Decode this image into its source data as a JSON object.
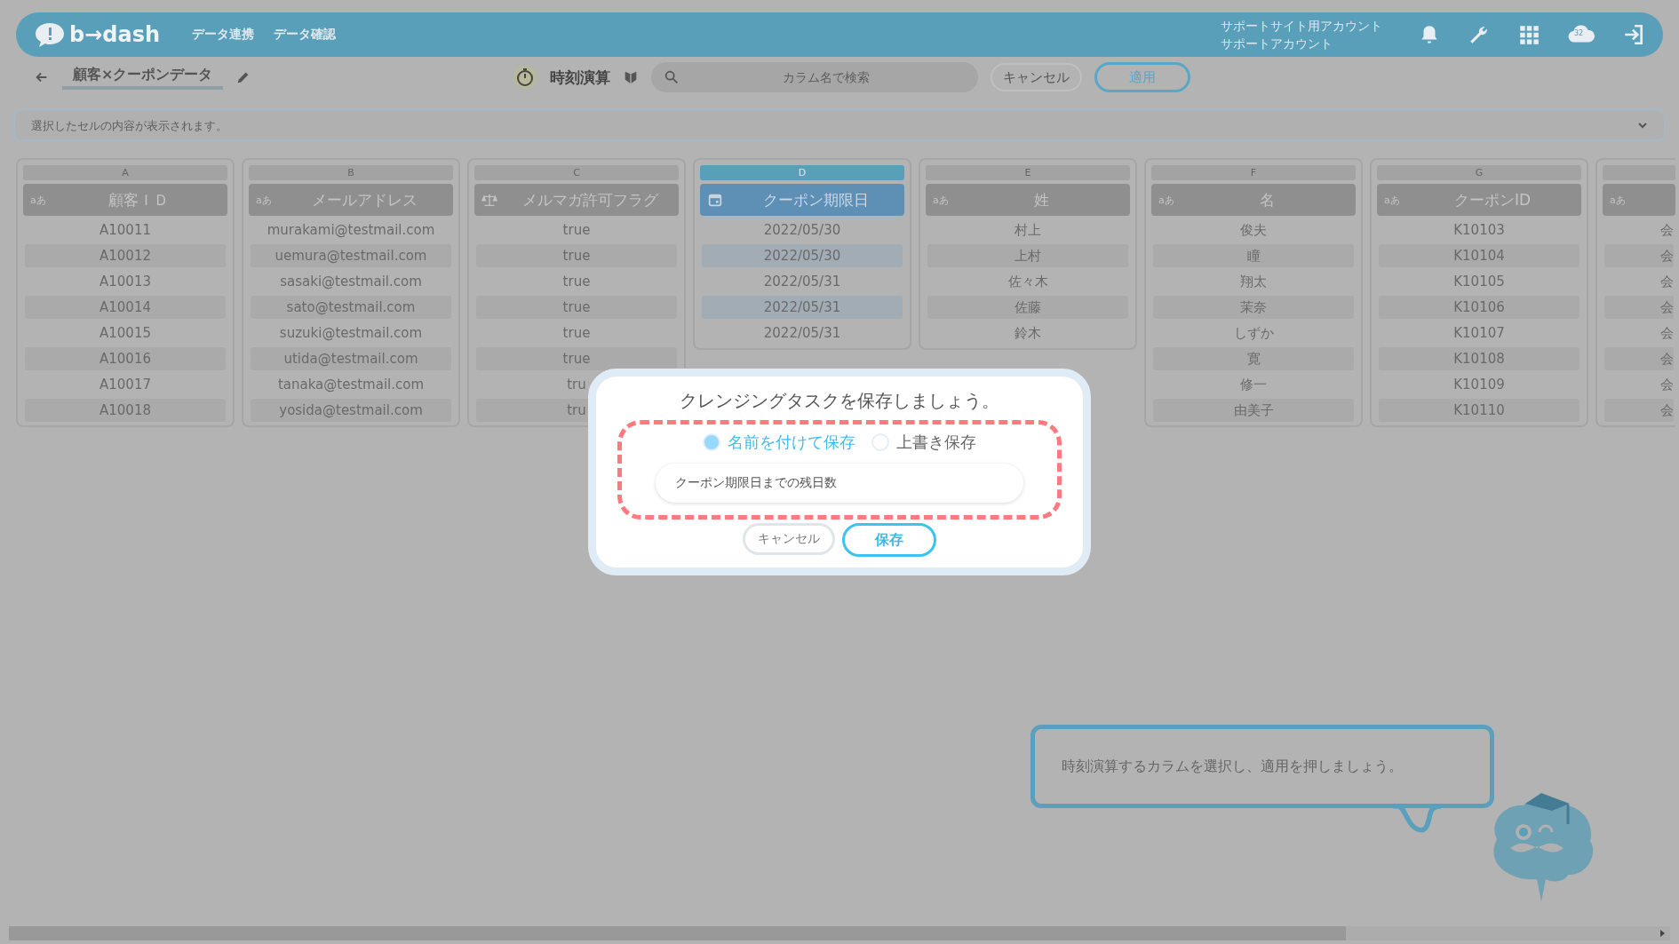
{
  "header": {
    "logo": "b→dash",
    "nav": [
      "データ連携",
      "データ確認"
    ],
    "account": [
      "サポートサイト用アカウント",
      "サポートアカウント"
    ],
    "badge": "32"
  },
  "toolbar": {
    "title": "顧客×クーポンデータ",
    "mode": "時刻演算",
    "search_placeholder": "カラム名で検索",
    "cancel": "キャンセル",
    "apply": "適用"
  },
  "cell_bar": {
    "placeholder": "選択したセルの内容が表示されます。"
  },
  "columns": [
    {
      "letter": "A",
      "name": "顧客ＩＤ",
      "kind": "text",
      "type_label": "aあ",
      "selected": false,
      "cells": [
        "A10011",
        "A10012",
        "A10013",
        "A10014",
        "A10015",
        "A10016",
        "A10017",
        "A10018"
      ]
    },
    {
      "letter": "B",
      "name": "メールアドレス",
      "kind": "text",
      "type_label": "aあ",
      "selected": false,
      "cells": [
        "murakami@testmail.com",
        "uemura@testmail.com",
        "sasaki@testmail.com",
        "sato@testmail.com",
        "suzuki@testmail.com",
        "utida@testmail.com",
        "tanaka@testmail.com",
        "yosida@testmail.com"
      ]
    },
    {
      "letter": "C",
      "name": "メルマガ許可フラグ",
      "kind": "flag",
      "selected": false,
      "cells": [
        "true",
        "true",
        "true",
        "true",
        "true",
        "true",
        "tru",
        "tru"
      ]
    },
    {
      "letter": "D",
      "name": "クーポン期限日",
      "kind": "date",
      "selected": true,
      "cells": [
        "2022/05/30",
        "2022/05/30",
        "2022/05/31",
        "2022/05/31",
        "2022/05/31"
      ]
    },
    {
      "letter": "E",
      "name": "姓",
      "kind": "text",
      "type_label": "aあ",
      "selected": false,
      "cells": [
        "村上",
        "上村",
        "佐々木",
        "佐藤",
        "鈴木"
      ]
    },
    {
      "letter": "F",
      "name": "名",
      "kind": "text",
      "type_label": "aあ",
      "selected": false,
      "cells": [
        "俊夫",
        "瞳",
        "翔太",
        "茉奈",
        "しずか",
        "寛",
        "修一",
        "由美子"
      ]
    },
    {
      "letter": "G",
      "name": "クーポンID",
      "kind": "text",
      "type_label": "aあ",
      "selected": false,
      "cells": [
        "K10103",
        "K10104",
        "K10105",
        "K10106",
        "K10107",
        "K10108",
        "K10109",
        "K10110"
      ]
    },
    {
      "kind": "text",
      "type_label": "aあ",
      "selected": false,
      "cells": [
        "会",
        "会",
        "会",
        "会",
        "会",
        "会",
        "会",
        "会"
      ]
    }
  ],
  "dialog": {
    "title": "クレンジングタスクを保存しましょう。",
    "options": [
      {
        "label": "名前を付けて保存",
        "selected": true
      },
      {
        "label": "上書き保存",
        "selected": false
      }
    ],
    "name_value": "クーポン期限日までの残日数",
    "cancel": "キャンセル",
    "save": "保存"
  },
  "tooltip": {
    "text": "時刻演算するカラムを選択し、適用を押しましょう。"
  }
}
